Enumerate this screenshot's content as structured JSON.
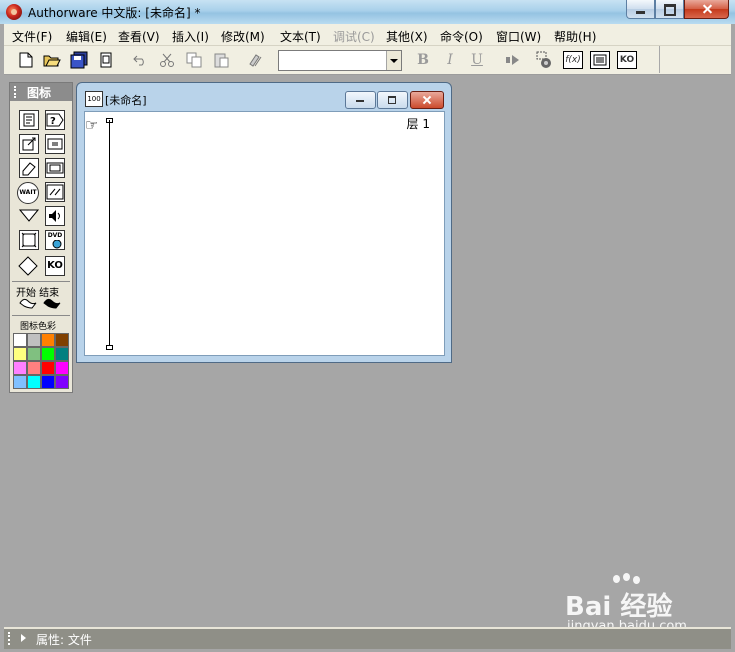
{
  "window": {
    "title": "Authorware 中文版: [未命名] *"
  },
  "menu": [
    {
      "label": "文件(F)",
      "enabled": true
    },
    {
      "label": "编辑(E)",
      "enabled": true
    },
    {
      "label": "查看(V)",
      "enabled": true
    },
    {
      "label": "插入(I)",
      "enabled": true
    },
    {
      "label": "修改(M)",
      "enabled": true
    },
    {
      "label": "文本(T)",
      "enabled": true
    },
    {
      "label": "调试(C)",
      "enabled": false
    },
    {
      "label": "其他(X)",
      "enabled": true
    },
    {
      "label": "命令(O)",
      "enabled": true
    },
    {
      "label": "窗口(W)",
      "enabled": true
    },
    {
      "label": "帮助(H)",
      "enabled": true
    }
  ],
  "toolbar": {
    "icons": [
      "new-file",
      "open-folder",
      "save-all",
      "import",
      "undo",
      "cut",
      "copy",
      "paste",
      "find",
      "style-combo",
      "bold",
      "italic",
      "underline",
      "run",
      "control-panel",
      "functions",
      "variables",
      "knowledge-objects"
    ],
    "bold_glyph": "B",
    "italic_glyph": "I",
    "underline_glyph": "U",
    "fn_label": "f(x)",
    "ko_label": "KO",
    "style_value": ""
  },
  "palette": {
    "title": "图标",
    "icons_left": [
      "display",
      "motion",
      "erase",
      "wait",
      "navigate",
      "framework",
      "decision"
    ],
    "icons_right": [
      "interaction",
      "calculation",
      "map",
      "digital-movie",
      "sound",
      "dvd",
      "knowledge-object"
    ],
    "wait_label": "WAIT",
    "dvd_label": "DVD",
    "ko_label": "KO",
    "flag_label": "开始 结束",
    "color_label": "图标色彩",
    "colors": [
      "#ffffff",
      "#c0c0c0",
      "#ff8000",
      "#804000",
      "#ffff80",
      "#80c080",
      "#00ff00",
      "#008080",
      "#ff80ff",
      "#ff8080",
      "#ff0000",
      "#ff00ff",
      "#80c0ff",
      "#00ffff",
      "#0000ff",
      "#8000ff"
    ]
  },
  "design_window": {
    "title": "[未命名]",
    "icon_label": "100",
    "layer_label": "层 1"
  },
  "status": {
    "text": "属性: 文件"
  },
  "watermark": {
    "brand": "Bai 经验",
    "domain": "jingyan.baidu.com"
  }
}
